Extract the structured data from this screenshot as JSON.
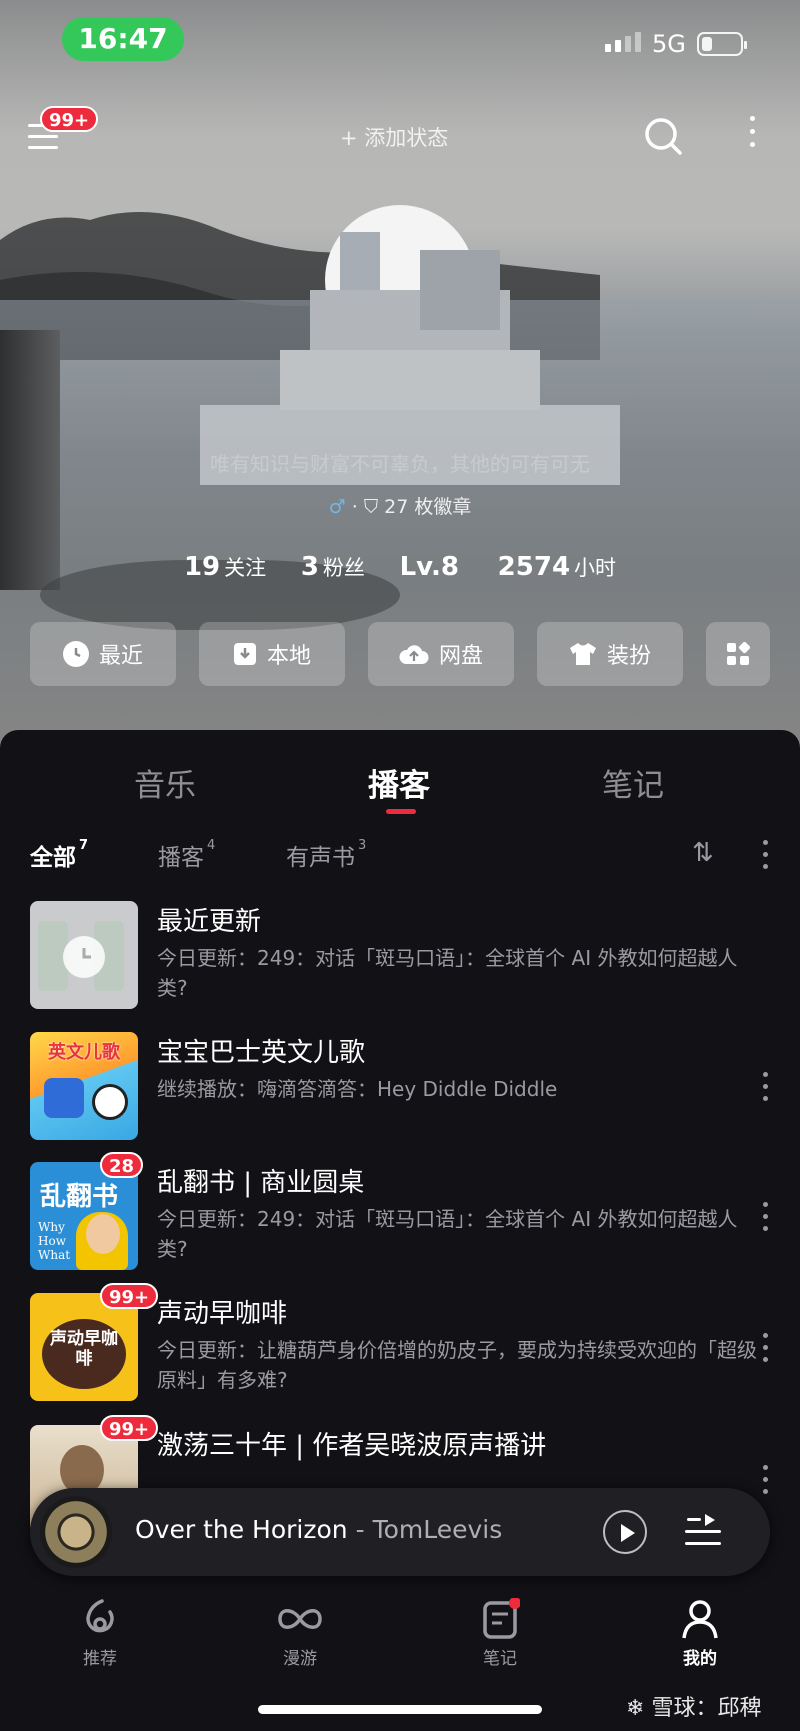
{
  "status_bar": {
    "time": "16:47",
    "network": "5G"
  },
  "header": {
    "notification_badge": "99+",
    "add_status": "+ 添加状态"
  },
  "profile": {
    "bio": "唯有知识与财富不可辜负，其他的可有可无",
    "gender_symbol": "♂",
    "separator": "·",
    "badges_text": "27 枚徽章",
    "stats": [
      {
        "value": "19",
        "label": "关注"
      },
      {
        "value": "3",
        "label": "粉丝"
      },
      {
        "value": "Lv.8",
        "label": ""
      },
      {
        "value": "2574",
        "label": "小时"
      }
    ]
  },
  "quick_actions": [
    {
      "label": "最近",
      "icon": "clock-icon"
    },
    {
      "label": "本地",
      "icon": "download-icon"
    },
    {
      "label": "网盘",
      "icon": "cloud-upload-icon"
    },
    {
      "label": "装扮",
      "icon": "shirt-icon"
    },
    {
      "label": "",
      "icon": "grid-icon"
    }
  ],
  "tabs": [
    {
      "label": "音乐",
      "active": false
    },
    {
      "label": "播客",
      "active": true
    },
    {
      "label": "笔记",
      "active": false
    }
  ],
  "filters": [
    {
      "label": "全部",
      "count": "7",
      "active": true
    },
    {
      "label": "播客",
      "count": "4",
      "active": false
    },
    {
      "label": "有声书",
      "count": "3",
      "active": false
    }
  ],
  "items": [
    {
      "title": "最近更新",
      "desc": "今日更新：249：对话「斑马口语」：全球首个 AI 外教如何超越人类?",
      "badge": ""
    },
    {
      "title": "宝宝巴士英文儿歌",
      "desc": "继续播放：嗨滴答滴答：Hey Diddle Diddle",
      "badge": "",
      "cover_text": "英文儿歌"
    },
    {
      "title": "乱翻书 | 商业圆桌",
      "desc": "今日更新：249：对话「斑马口语」：全球首个 AI 外教如何超越人类?",
      "badge": "28",
      "cover_text": "乱翻书"
    },
    {
      "title": "声动早咖啡",
      "desc": "今日更新：让糖葫芦身价倍增的奶皮子，要成为持续受欢迎的「超级原料」有多难?",
      "badge": "99+",
      "cover_text": "声动早咖啡"
    },
    {
      "title": "激荡三十年 | 作者吴晓波原声播讲",
      "desc": "",
      "badge": "99+"
    }
  ],
  "player": {
    "song": "Over the Horizon",
    "dash": " - ",
    "artist": "TomLeevis"
  },
  "nav": [
    {
      "label": "推荐",
      "active": false
    },
    {
      "label": "漫游",
      "active": false
    },
    {
      "label": "笔记",
      "active": false
    },
    {
      "label": "我的",
      "active": true
    }
  ],
  "watermark": "雪球：邱稗",
  "colors": {
    "accent": "#ee2b3c",
    "background": "#111116",
    "time_pill": "#34c759"
  }
}
